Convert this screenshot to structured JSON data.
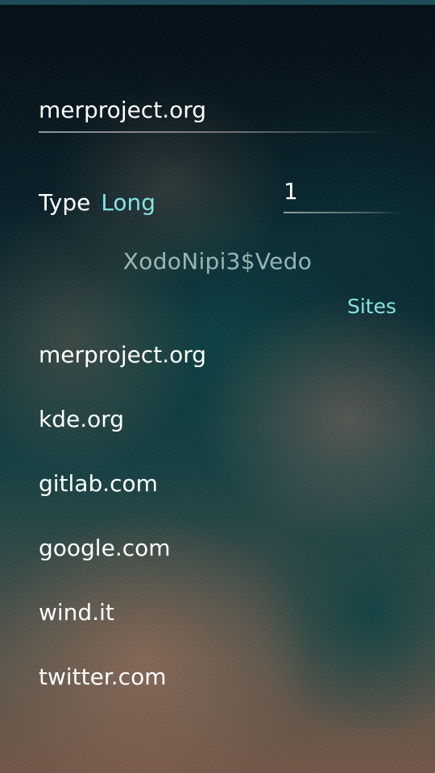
{
  "site_field": {
    "value": "merproject.org"
  },
  "type_selector": {
    "label": "Type",
    "value": "Long"
  },
  "counter_field": {
    "value": "1"
  },
  "generated_password": "XodoNipi3$Vedo",
  "sites_section": {
    "header": "Sites",
    "items": [
      {
        "label": "merproject.org"
      },
      {
        "label": "kde.org"
      },
      {
        "label": "gitlab.com"
      },
      {
        "label": "google.com"
      },
      {
        "label": "wind.it"
      },
      {
        "label": "twitter.com"
      }
    ]
  },
  "colors": {
    "highlight": "#86e3e3",
    "primary_text": "#ffffff",
    "secondary_text": "#cde4e4"
  }
}
